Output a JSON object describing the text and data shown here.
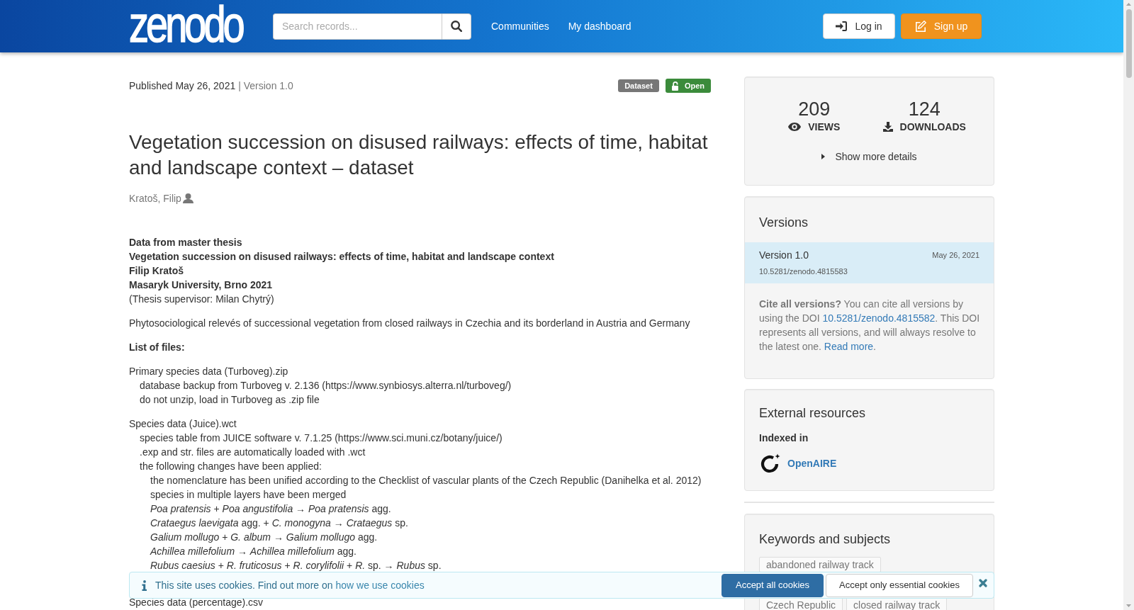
{
  "header": {
    "logo": "zenodo",
    "search": {
      "placeholder": "Search records..."
    },
    "nav_links": [
      "Communities",
      "My dashboard"
    ],
    "buttons": [
      {
        "kind": "login",
        "label": "Log in"
      },
      {
        "kind": "signup",
        "label": "Sign up"
      }
    ]
  },
  "record": {
    "published": "Published May 26, 2021",
    "version": "| Version 1.0",
    "badges": [
      {
        "kind": "type",
        "label": "Dataset"
      },
      {
        "kind": "access",
        "label": "Open"
      }
    ],
    "title": "Vegetation succession on disused railways: effects of time, habitat and landscape context – dataset",
    "creators": [
      "Kratoš, Filip"
    ],
    "description": [
      {
        "kind": "paragraph",
        "lines": [
          {
            "text": "Data from master thesis",
            "bold": true
          },
          {
            "text": "Vegetation succession on disused railways: effects of time, habitat and landscape context",
            "bold": true
          },
          {
            "text": "Filip Kratoš",
            "bold": true
          },
          {
            "text": "Masaryk University, Brno 2021",
            "bold": true
          },
          {
            "text": "(Thesis supervisor: Milan Chytrý)",
            "bold": false
          }
        ]
      },
      {
        "kind": "paragraph",
        "lines": [
          {
            "text": "Phytosociological relevés of successional vegetation from closed railways in Czechia and its borderland in Austria and Germany",
            "bold": false
          }
        ]
      },
      {
        "kind": "paragraph",
        "lines": [
          {
            "text": "List of files:",
            "bold": true
          }
        ]
      },
      {
        "kind": "tree",
        "items": [
          {
            "text": "Primary species data (Turboveg).zip",
            "children": [
              {
                "text": "database backup from Turboveg v. 2.136 (https://www.synbiosys.alterra.nl/turboveg/)"
              },
              {
                "text": "do not unzip, load in Turboveg as .zip file"
              }
            ]
          }
        ]
      },
      {
        "kind": "tree",
        "items": [
          {
            "text": "Species data (Juice).wct",
            "children": [
              {
                "text": "species table from JUICE software v. 7.1.25 (https://www.sci.muni.cz/botany/juice/)"
              },
              {
                "text": ".exp and str. files are automatically loaded with .wct"
              },
              {
                "text": "the following changes have been applied:",
                "children": [
                  {
                    "text": "the nomenclature has been unified according to the Checklist of vascular plants of the Czech Republic (Danihelka et al. 2012)"
                  },
                  {
                    "text": "species in multiple layers have been merged"
                  },
                  {
                    "text": "*Poa pratensis* + *Poa angustifolia* → *Poa pratensis* agg."
                  },
                  {
                    "text": "*Crataegus laevigata* agg. + *C. monogyna* → *Crataegus* sp."
                  },
                  {
                    "text": "*Galium mollugo* + *G. album* → *Galium mollugo* agg."
                  },
                  {
                    "text": "*Achillea millefolium* → *Achillea millefolium* agg."
                  },
                  {
                    "text": "*Rubus caesius* + *R. fruticosus* + *R. corylifolii* + *R.* sp. → *Rubus* sp."
                  }
                ]
              }
            ]
          }
        ]
      },
      {
        "kind": "tree",
        "items": [
          {
            "text": "Species data (percentage).csv"
          }
        ]
      }
    ]
  },
  "stats_panel": {
    "stats": [
      {
        "kind": "views",
        "value": "209",
        "label": "VIEWS"
      },
      {
        "kind": "downloads",
        "value": "124",
        "label": "DOWNLOADS"
      }
    ],
    "details_toggle": {
      "label": "Show more details",
      "expanded": false
    }
  },
  "versions": {
    "title": "Versions",
    "items": [
      {
        "label": "Version 1.0",
        "date": "May 26, 2021",
        "doi": "10.5281/zenodo.4815583",
        "selected": true
      }
    ],
    "note": [
      {
        "kind": "bold",
        "text": "Cite all versions?"
      },
      {
        "kind": "text",
        "text": " You can cite all versions by using the DOI "
      },
      {
        "kind": "link",
        "text": "10.5281/zenodo.4815582"
      },
      {
        "kind": "text",
        "text": ". This DOI represents all versions, and will always resolve to the latest one. "
      },
      {
        "kind": "link",
        "text": "Read more"
      },
      {
        "kind": "text",
        "text": "."
      }
    ]
  },
  "external_resources": {
    "title": "External resources",
    "subtitle": "Indexed in",
    "sources": [
      "OpenAIRE"
    ]
  },
  "keywords": {
    "title": "Keywords and subjects",
    "rows": [
      [
        "abandoned railway track"
      ],
      [
        "Czech Republic",
        "closed railway track"
      ]
    ]
  },
  "cookie_banner": {
    "message": [
      {
        "kind": "text",
        "text": "This site uses cookies. Find out more on "
      },
      {
        "kind": "link",
        "text": "how we use cookies"
      }
    ],
    "buttons": [
      {
        "kind": "primary",
        "label": "Accept all cookies"
      },
      {
        "kind": "secondary",
        "label": "Accept only essential cookies"
      }
    ]
  }
}
